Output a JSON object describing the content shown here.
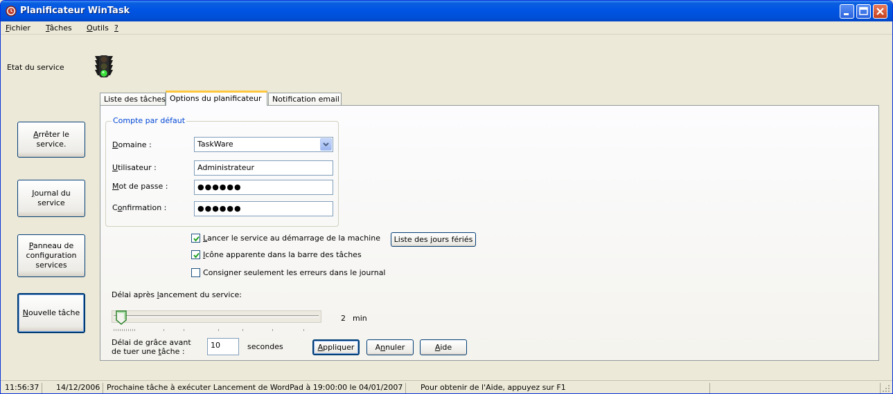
{
  "window": {
    "title": "Planificateur WinTask"
  },
  "menu": [
    {
      "label": "Fichier",
      "mnemonic": "F",
      "rest": "ichier"
    },
    {
      "label": "Tâches",
      "mnemonic": "T",
      "rest": "âches"
    },
    {
      "label": "Outils",
      "mnemonic": "O",
      "rest": "utils"
    },
    {
      "label": "?",
      "mnemonic": "?",
      "rest": ""
    }
  ],
  "service": {
    "etat_label": "Etat du service",
    "status_icon": "traffic-light-green-icon"
  },
  "sidebar": {
    "stop": {
      "line1": "Arrêter le",
      "line1_mn": "A",
      "line1_rest": "rrêter le",
      "line2": "service."
    },
    "journal": {
      "line1": "Journal du",
      "line1_mn": "J",
      "line1_rest": "ournal du",
      "line2": "service"
    },
    "panneau": {
      "line1": "Panneau de",
      "line1_mn": "P",
      "line1_rest": "anneau de",
      "line2": "configuration",
      "line3": "services"
    },
    "new_task": {
      "label": "Nouvelle tâche",
      "mn": "N",
      "rest": "ouvelle tâche"
    }
  },
  "tabs": [
    {
      "label": "Liste des tâches",
      "active": false
    },
    {
      "label": "Options du planificateur",
      "active": true
    },
    {
      "label": "Notification email",
      "active": false
    }
  ],
  "account": {
    "group_title": "Compte par défaut",
    "domain_label_mn": "D",
    "domain_label_rest": "omaine :",
    "domain_value": "TaskWare",
    "user_label_mn": "U",
    "user_label_rest": "tilisateur :",
    "user_value": "Administrateur",
    "password_label_mn": "M",
    "password_label_rest": "ot de passe :",
    "password_value": "●●●●●●",
    "confirm_label_pre": "C",
    "confirm_label_mn": "o",
    "confirm_label_rest": "nfirmation :",
    "confirm_value": "●●●●●●"
  },
  "options": {
    "launch_at_boot": {
      "mn": "L",
      "rest": "ancer le service au démarrage de la machine",
      "checked": true
    },
    "tray_icon": {
      "mn": "I",
      "rest": "cône apparente dans la barre des tâches",
      "checked": true
    },
    "log_errors_only": {
      "label": "Consigner seulement les erreurs dans le journal",
      "checked": false
    },
    "holidays_button": {
      "pre": "Liste des ",
      "mn": "j",
      "rest": "ours fériés"
    }
  },
  "delay": {
    "label_pre": "Délai après ",
    "label_mn": "l",
    "label_rest": "ancement du service:",
    "value": 2,
    "unit": "min"
  },
  "grace": {
    "label_line1": "Délai de grâce avant",
    "label_line2_pre": "de tuer une ",
    "label_line2_mn": "t",
    "label_line2_rest": "âche :",
    "value": "10",
    "unit": "secondes"
  },
  "buttons": {
    "apply": {
      "mn": "A",
      "rest": "ppliquer"
    },
    "cancel": {
      "pre": "A",
      "mn": "n",
      "rest": "nuler"
    },
    "help": {
      "mn": "A",
      "rest": "ide"
    }
  },
  "statusbar": {
    "time": "11:56:37",
    "date": "14/12/2006",
    "next_task": "Prochaine tâche à exécuter  Lancement de WordPad à 19:00:00 le 04/01/2007",
    "hint": "Pour obtenir de l'Aide, appuyez sur F1"
  }
}
